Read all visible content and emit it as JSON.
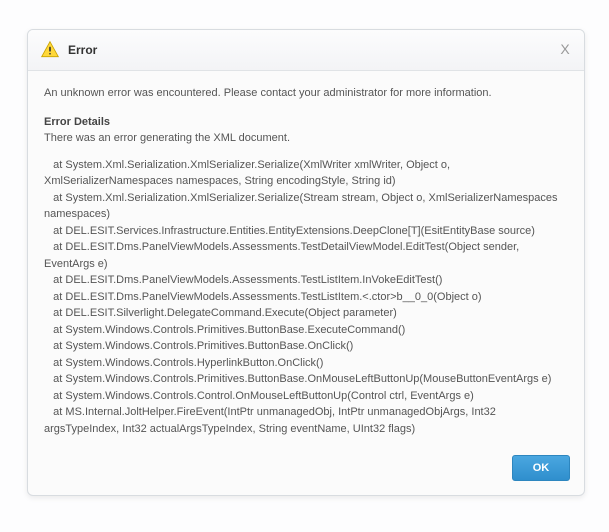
{
  "dialog": {
    "title": "Error",
    "close_glyph": "X",
    "intro": "An unknown error was encountered. Please contact your administrator for more information.",
    "details_heading": "Error Details",
    "details_message": "There was an error generating the XML document.",
    "stack": "   at System.Xml.Serialization.XmlSerializer.Serialize(XmlWriter xmlWriter, Object o, XmlSerializerNamespaces namespaces, String encodingStyle, String id)\n   at System.Xml.Serialization.XmlSerializer.Serialize(Stream stream, Object o, XmlSerializerNamespaces namespaces)\n   at DEL.ESIT.Services.Infrastructure.Entities.EntityExtensions.DeepClone[T](EsitEntityBase source)\n   at DEL.ESIT.Dms.PanelViewModels.Assessments.TestDetailViewModel.EditTest(Object sender, EventArgs e)\n   at DEL.ESIT.Dms.PanelViewModels.Assessments.TestListItem.InVokeEditTest()\n   at DEL.ESIT.Dms.PanelViewModels.Assessments.TestListItem.<.ctor>b__0_0(Object o)\n   at DEL.ESIT.Silverlight.DelegateCommand.Execute(Object parameter)\n   at System.Windows.Controls.Primitives.ButtonBase.ExecuteCommand()\n   at System.Windows.Controls.Primitives.ButtonBase.OnClick()\n   at System.Windows.Controls.HyperlinkButton.OnClick()\n   at System.Windows.Controls.Primitives.ButtonBase.OnMouseLeftButtonUp(MouseButtonEventArgs e)\n   at System.Windows.Controls.Control.OnMouseLeftButtonUp(Control ctrl, EventArgs e)\n   at MS.Internal.JoltHelper.FireEvent(IntPtr unmanagedObj, IntPtr unmanagedObjArgs, Int32 argsTypeIndex, Int32 actualArgsTypeIndex, String eventName, UInt32 flags)",
    "ok_label": "OK"
  }
}
